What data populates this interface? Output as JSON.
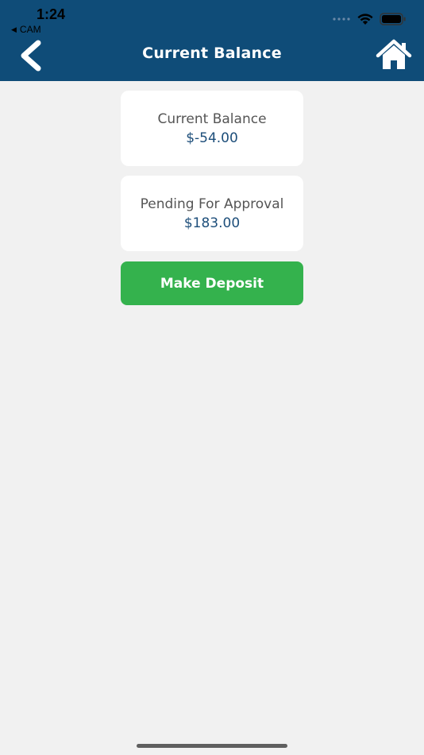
{
  "status_bar": {
    "time": "1:24",
    "back_app": "CAM",
    "back_arrow": "◀"
  },
  "nav": {
    "title": "Current Balance",
    "back_icon": "chevron-left-icon",
    "home_icon": "home-icon"
  },
  "balance_card": {
    "label": "Current Balance",
    "value": "$-54.00"
  },
  "pending_card": {
    "label": "Pending For Approval",
    "value": "$183.00"
  },
  "actions": {
    "deposit_label": "Make Deposit"
  },
  "colors": {
    "header": "#0f4c78",
    "background": "#f1f1f1",
    "button": "#34b24d",
    "value_text": "#1d4e7a"
  }
}
